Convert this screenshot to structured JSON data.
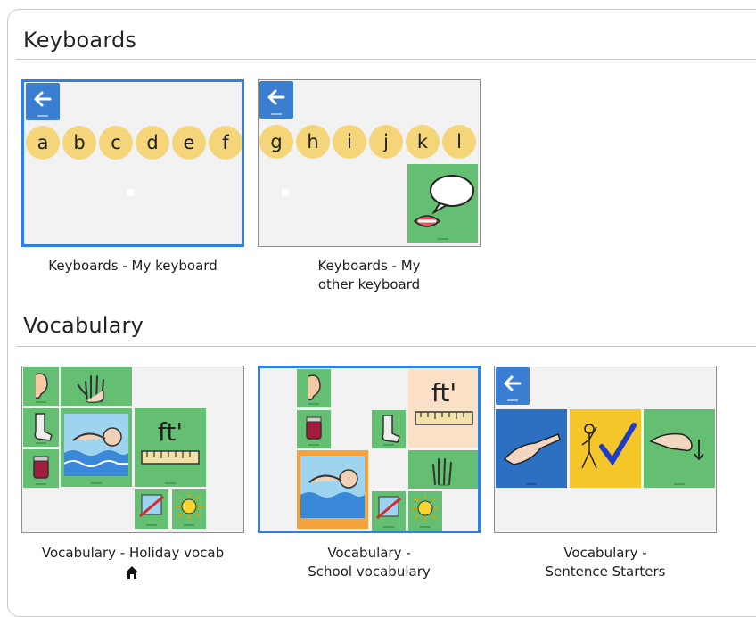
{
  "sections": [
    {
      "title": "Keyboards"
    },
    {
      "title": "Vocabulary"
    }
  ],
  "keyboards": {
    "board1": {
      "caption": "Keyboards - My keyboard",
      "keys": [
        "a",
        "b",
        "c",
        "d",
        "e",
        "f"
      ]
    },
    "board2": {
      "caption_line1": "Keyboards - My",
      "caption_line2": "other keyboard",
      "keys": [
        "g",
        "h",
        "i",
        "j",
        "k",
        "l"
      ]
    }
  },
  "vocabulary": {
    "board1": {
      "caption": "Vocabulary - Holiday vocab",
      "ruler_text": "ft'"
    },
    "board2": {
      "caption_line1": "Vocabulary -",
      "caption_line2": "School vocabulary",
      "ruler_text": "ft'"
    },
    "board3": {
      "caption_line1": "Vocabulary -",
      "caption_line2": "Sentence Starters"
    }
  },
  "colors": {
    "selected_border": "#2f7fe8",
    "tile_green": "#64bf72",
    "key_yellow": "#f4d57a",
    "back_blue": "#3a7ed2"
  }
}
